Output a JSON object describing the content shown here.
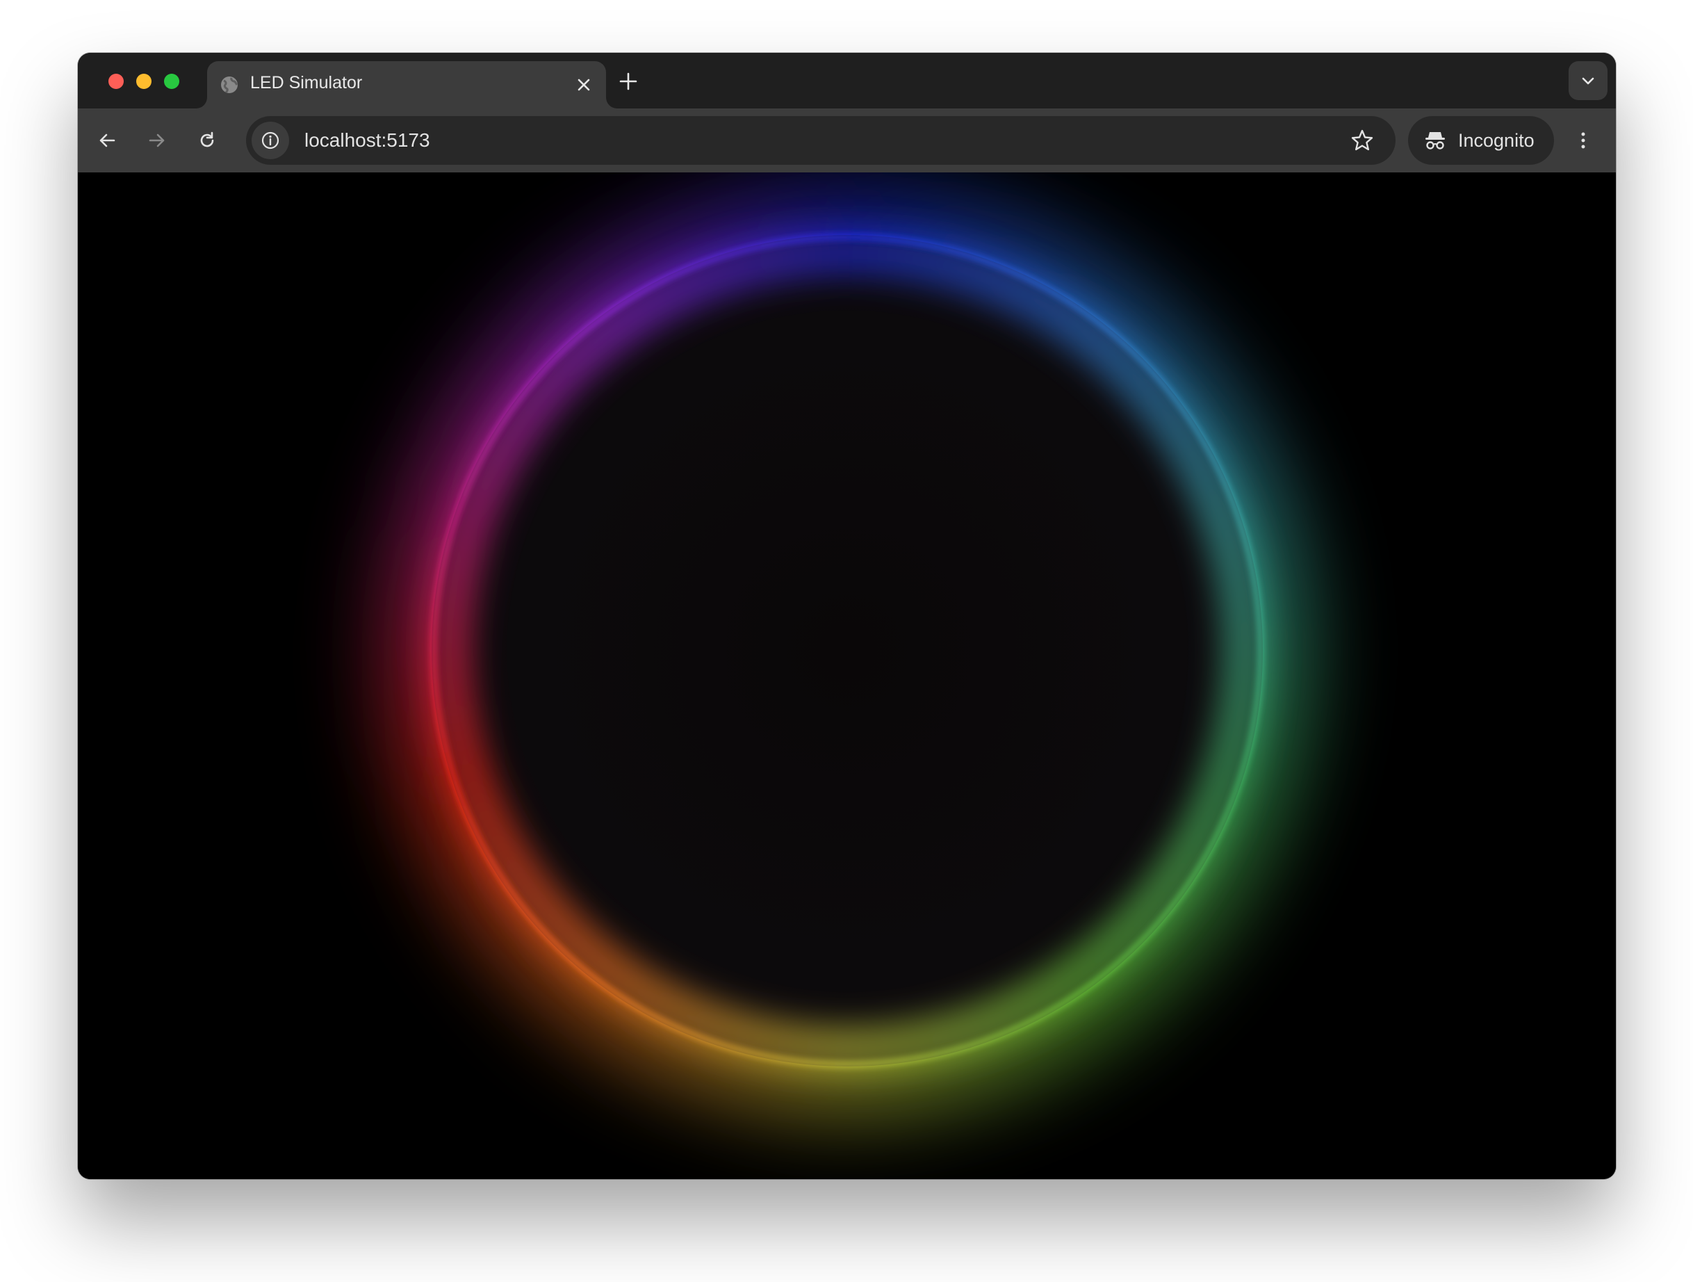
{
  "browser": {
    "tab": {
      "title": "LED Simulator",
      "favicon": "globe-icon"
    },
    "address_bar": {
      "url": "localhost:5173"
    },
    "profile": {
      "label": "Incognito"
    },
    "icons": {
      "back": "arrow-left-icon",
      "forward": "arrow-right-icon",
      "reload": "reload-icon",
      "site_info": "info-icon",
      "bookmark": "star-icon",
      "incognito": "incognito-icon",
      "menu": "kebab-menu-icon",
      "new_tab": "plus-icon",
      "tab_close": "close-icon",
      "tab_search": "chevron-down-icon"
    },
    "colors": {
      "frame": "#1f1f1f",
      "toolbar": "#3c3c3c",
      "omnibox": "#282828",
      "text": "#e3e3e3"
    }
  },
  "led_ring": {
    "background": "#000000",
    "gradient_colors": [
      "#1f2ee8",
      "#2f7de0",
      "#3fb6b0",
      "#46c46a",
      "#6fd03e",
      "#c9c83a",
      "#ff7b22",
      "#ff2a1e",
      "#d7248c",
      "#9a2ae6"
    ]
  }
}
